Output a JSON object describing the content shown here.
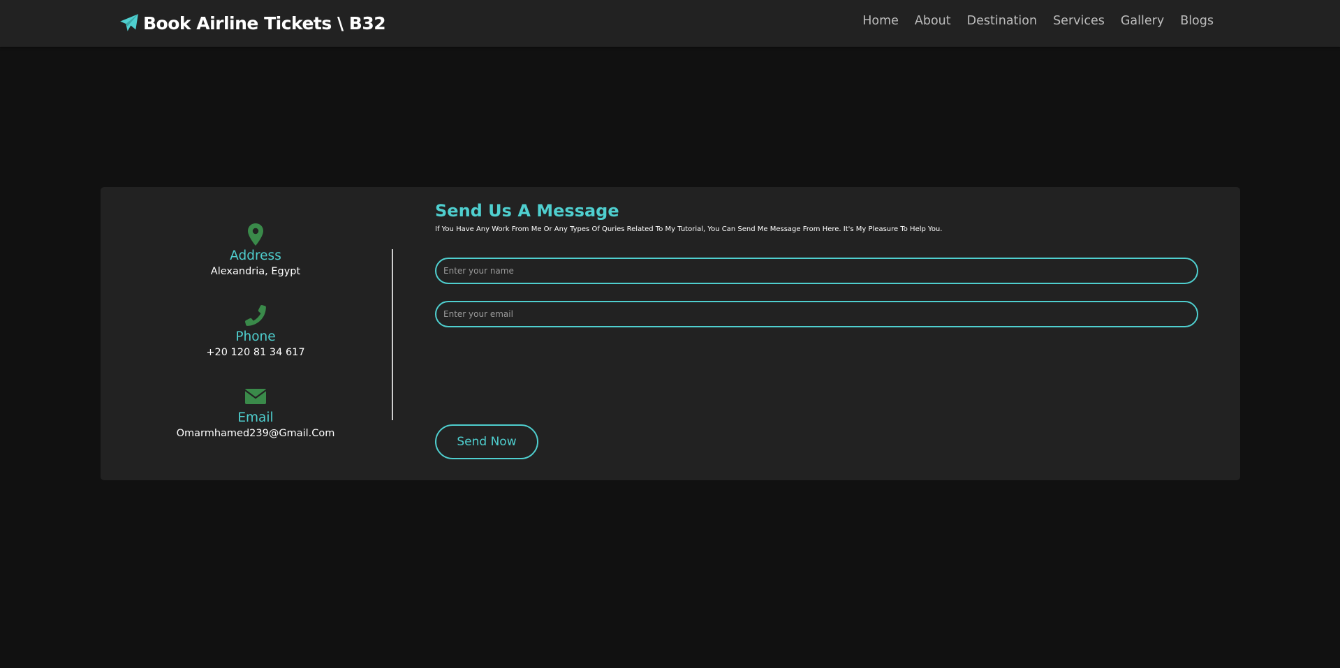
{
  "brand": {
    "title": "Book Airline Tickets \\ B32",
    "icon": "paper-plane-icon",
    "accent_color": "#4fcfcf"
  },
  "nav": {
    "items": [
      "Home",
      "About",
      "Destination",
      "Services",
      "Gallery",
      "Blogs"
    ]
  },
  "contact_info": {
    "address": {
      "icon": "map-marker-icon",
      "label": "Address",
      "value": "Alexandria, Egypt"
    },
    "phone": {
      "icon": "phone-icon",
      "label": "Phone",
      "value": "+20 120 81 34 617"
    },
    "email": {
      "icon": "envelope-icon",
      "label": "Email",
      "value": "Omarmhamed239@Gmail.Com"
    },
    "icon_color": "#3a8a4a"
  },
  "form": {
    "title": "Send Us A Message",
    "subtitle": "If You Have Any Work From Me Or Any Types Of Quries Related To My Tutorial, You Can Send Me Message From Here. It's My Pleasure To Help You.",
    "name_placeholder": "Enter your name",
    "email_placeholder": "Enter your email",
    "submit_label": "Send Now"
  },
  "colors": {
    "background": "#111111",
    "surface": "#222222",
    "accent": "#4fcfcf"
  }
}
